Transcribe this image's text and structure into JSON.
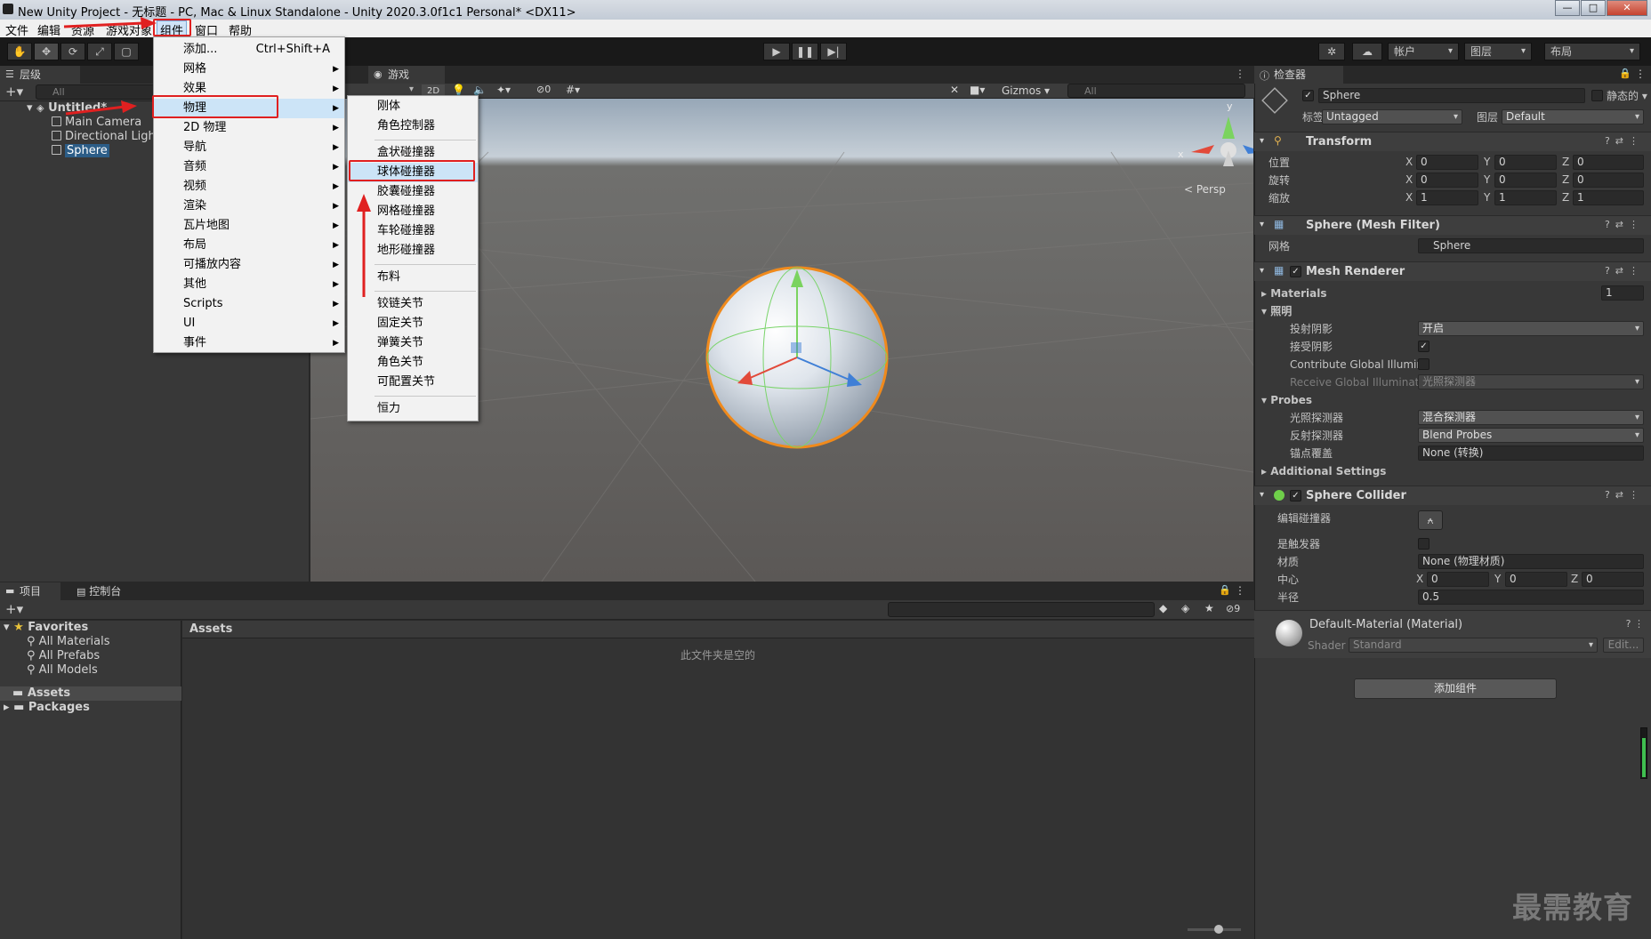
{
  "window": {
    "title": "New Unity Project - 无标题 - PC, Mac & Linux Standalone - Unity 2020.3.0f1c1 Personal* <DX11>",
    "controls": {
      "minimize": "—",
      "maximize": "□",
      "close": "✕"
    }
  },
  "menubar": {
    "items": [
      "文件",
      "编辑",
      "资源",
      "游戏对象",
      "组件",
      "窗口",
      "帮助"
    ]
  },
  "toolbar": {
    "account": "帐户",
    "layers": "图层",
    "layout": "布局"
  },
  "hierarchy": {
    "tab": "层级",
    "search_placeholder": "All",
    "scene": "Untitled*",
    "objects": [
      "Main Camera",
      "Directional Light",
      "Sphere"
    ]
  },
  "game_view": {
    "tab": "游戏",
    "mode_2d": "2D",
    "hidden_count": "0",
    "gizmos": "Gizmos",
    "search_placeholder": "All",
    "persp_label": "< Persp",
    "axis_labels": {
      "y": "y",
      "x": "x",
      "z": "z"
    }
  },
  "component_menu": {
    "items": [
      {
        "label": "添加...",
        "shortcut": "Ctrl+Shift+A"
      },
      {
        "label": "网格",
        "arrow": "▶"
      },
      {
        "label": "效果",
        "arrow": "▶"
      },
      {
        "label": "物理",
        "arrow": "▶"
      },
      {
        "label": "2D 物理",
        "arrow": "▶"
      },
      {
        "label": "导航",
        "arrow": "▶"
      },
      {
        "label": "音频",
        "arrow": "▶"
      },
      {
        "label": "视频",
        "arrow": "▶"
      },
      {
        "label": "渲染",
        "arrow": "▶"
      },
      {
        "label": "瓦片地图",
        "arrow": "▶"
      },
      {
        "label": "布局",
        "arrow": "▶"
      },
      {
        "label": "可播放内容",
        "arrow": "▶"
      },
      {
        "label": "其他",
        "arrow": "▶"
      },
      {
        "label": "Scripts",
        "arrow": "▶"
      },
      {
        "label": "UI",
        "arrow": "▶"
      },
      {
        "label": "事件",
        "arrow": "▶"
      }
    ]
  },
  "physics_submenu": {
    "items": [
      "刚体",
      "角色控制器",
      "盒状碰撞器",
      "球体碰撞器",
      "胶囊碰撞器",
      "网格碰撞器",
      "车轮碰撞器",
      "地形碰撞器",
      "布料",
      "铰链关节",
      "固定关节",
      "弹簧关节",
      "角色关节",
      "可配置关节",
      "恒力"
    ]
  },
  "inspector": {
    "tab": "检查器",
    "object_name": "Sphere",
    "static_label": "静态的",
    "tag_label": "标签",
    "tag_value": "Untagged",
    "layer_label": "图层",
    "layer_value": "Default",
    "transform": {
      "title": "Transform",
      "rows": [
        {
          "label": "位置",
          "x": "0",
          "y": "0",
          "z": "0"
        },
        {
          "label": "旋转",
          "x": "0",
          "y": "0",
          "z": "0"
        },
        {
          "label": "缩放",
          "x": "1",
          "y": "1",
          "z": "1"
        }
      ]
    },
    "mesh_filter": {
      "title": "Sphere (Mesh Filter)",
      "mesh_label": "网格",
      "mesh_value": "Sphere"
    },
    "mesh_renderer": {
      "title": "Mesh Renderer",
      "materials_label": "Materials",
      "materials_count": "1",
      "lighting_label": "照明",
      "cast_shadows_label": "投射阴影",
      "cast_shadows_value": "开启",
      "receive_shadows_label": "接受阴影",
      "contribute_gi_label": "Contribute Global Illumir",
      "receive_gi_label": "Receive Global Illuminati",
      "receive_gi_value": "光照探测器",
      "probes_label": "Probes",
      "light_probes_label": "光照探测器",
      "light_probes_value": "混合探测器",
      "reflection_probes_label": "反射探测器",
      "reflection_probes_value": "Blend Probes",
      "anchor_label": "锚点覆盖",
      "anchor_value": "None (转换)",
      "additional_label": "Additional Settings"
    },
    "sphere_collider": {
      "title": "Sphere Collider",
      "edit_label": "编辑碰撞器",
      "trigger_label": "是触发器",
      "material_label": "材质",
      "material_value": "None (物理材质)",
      "center_label": "中心",
      "center": {
        "x": "0",
        "y": "0",
        "z": "0"
      },
      "radius_label": "半径",
      "radius_value": "0.5"
    },
    "material": {
      "title": "Default-Material (Material)",
      "shader_label": "Shader",
      "shader_value": "Standard",
      "edit_label": "Edit..."
    },
    "add_component": "添加组件"
  },
  "project": {
    "tab_project": "项目",
    "tab_console": "控制台",
    "favorites_label": "Favorites",
    "favorites": [
      "All Materials",
      "All Prefabs",
      "All Models"
    ],
    "roots": [
      "Assets",
      "Packages"
    ],
    "assets_header": "Assets",
    "empty_text": "此文件夹是空的",
    "hidden_count": "9"
  },
  "watermark": "最需教育",
  "colors": {
    "accent_red": "#e02020",
    "selection": "#2c5d87",
    "menu_highlight": "#cce4f7"
  }
}
